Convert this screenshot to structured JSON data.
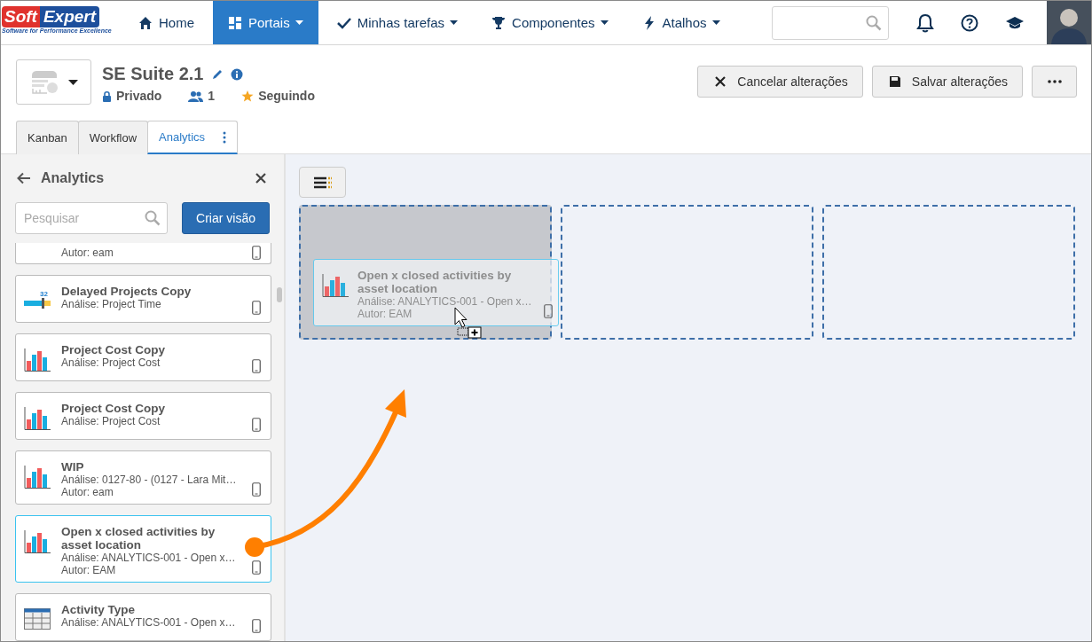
{
  "nav": {
    "logo": {
      "left": "Soft",
      "right": "Expert",
      "tagline": "Software for Performance Excellence"
    },
    "items": [
      {
        "label": "Home",
        "kind": "home",
        "dropdown": false,
        "selected": false
      },
      {
        "label": "Portais",
        "kind": "portal",
        "dropdown": true,
        "selected": true
      },
      {
        "label": "Minhas tarefas",
        "kind": "check",
        "dropdown": true,
        "selected": false
      },
      {
        "label": "Componentes",
        "kind": "trophy",
        "dropdown": true,
        "selected": false
      },
      {
        "label": "Atalhos",
        "kind": "bolt",
        "dropdown": true,
        "selected": false
      }
    ]
  },
  "header": {
    "title": "SE Suite 2.1",
    "privacy": "Privado",
    "members": "1",
    "follow": "Seguindo",
    "buttons": [
      {
        "label": "Cancelar alterações",
        "kind": "cancel"
      },
      {
        "label": "Salvar alterações",
        "kind": "save"
      },
      {
        "kind": "more"
      }
    ]
  },
  "tabs": [
    {
      "label": "Kanban",
      "selected": false
    },
    {
      "label": "Workflow",
      "selected": false
    },
    {
      "label": "Analytics",
      "selected": true
    }
  ],
  "sidebar": {
    "title": "Analytics",
    "search": {
      "placeholder": "Pesquisar"
    },
    "create_button": "Criar visão",
    "cards": [
      {
        "kind": "cut",
        "author": "Autor: eam",
        "selected": false
      },
      {
        "kind": "gauge",
        "icon_value": "32",
        "title": "Delayed Projects Copy",
        "analysis": "Análise: Project Time",
        "selected": false
      },
      {
        "kind": "chart",
        "title": "Project Cost Copy",
        "analysis": "Análise: Project Cost",
        "selected": false
      },
      {
        "kind": "chart",
        "title": "Project Cost Copy",
        "analysis": "Análise: Project Cost",
        "selected": false
      },
      {
        "kind": "chart",
        "title": "WIP",
        "analysis": "Análise: 0127-80 - (0127 - Lara Mit…",
        "author": "Autor: eam",
        "selected": false
      },
      {
        "kind": "chart",
        "title": "Open x closed activities by asset location",
        "analysis": "Análise: ANALYTICS-001 - Open x…",
        "author": "Autor: EAM",
        "selected": true
      },
      {
        "kind": "table",
        "title": "Activity Type",
        "analysis": "Análise: ANALYTICS-001 - Open x…",
        "selected": false
      }
    ]
  },
  "canvas": {
    "drop_zones": [
      {
        "highlighted": true
      },
      {
        "highlighted": false
      },
      {
        "highlighted": false
      }
    ],
    "dragged_card": {
      "kind": "chart",
      "title": "Open x closed activities by asset location",
      "analysis": "Análise: ANALYTICS-001 - Open x…",
      "author": "Autor: EAM"
    }
  }
}
